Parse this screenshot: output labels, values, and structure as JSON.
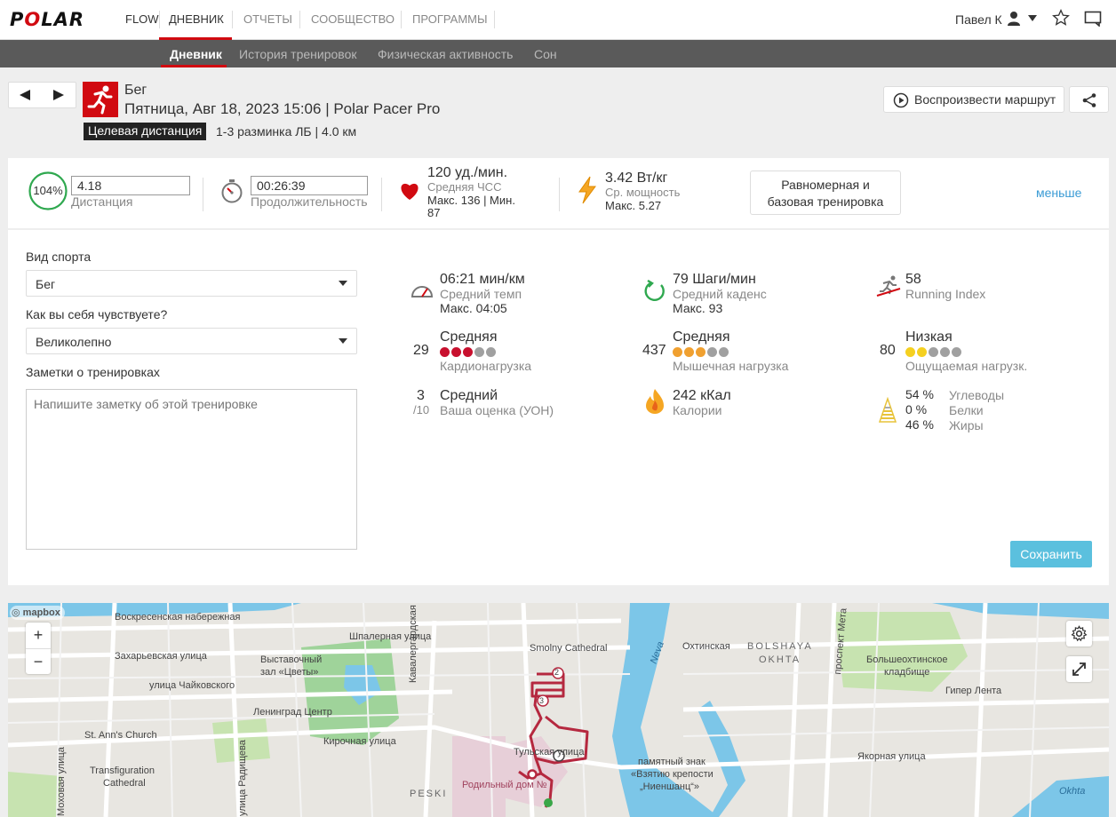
{
  "nav": {
    "logo": "POLAR",
    "flow": "FLOW",
    "items": [
      "ДНЕВНИК",
      "ОТЧЕТЫ",
      "СООБЩЕСТВО",
      "ПРОГРАММЫ"
    ],
    "user": "Павел К"
  },
  "subnav": [
    "Дневник",
    "История тренировок",
    "Физическая активность",
    "Сон"
  ],
  "session": {
    "sport": "Бег",
    "datetime": "Пятница, Авг 18, 2023 15:06 | Polar Pacer Pro",
    "target_badge": "Целевая дистанция",
    "target_text": "1-3 разминка ЛБ | 4.0 км",
    "replay": "Воспроизвести маршрут"
  },
  "summary": {
    "percent": "104%",
    "distance_value": "4.18",
    "distance_label": "Дистанция",
    "duration_value": "00:26:39",
    "duration_label": "Продолжительность",
    "hr_value": "120 уд./мин.",
    "hr_label": "Средняя ЧСС",
    "hr_minmax": "Макс. 136  |  Мин.",
    "hr_min": "87",
    "power_value": "3.42 Вт/кг",
    "power_label": "Ср. мощность",
    "power_max": "Макс. 5.27",
    "training_benefit_1": "Равномерная и",
    "training_benefit_2": "базовая тренировка",
    "less": "меньше"
  },
  "form": {
    "sport_label": "Вид спорта",
    "sport_value": "Бег",
    "feeling_label": "Как вы себя чувствуете?",
    "feeling_value": "Великолепно",
    "notes_label": "Заметки о тренировках",
    "notes_placeholder": "Напишите заметку об этой тренировке",
    "save": "Сохранить"
  },
  "metrics": {
    "pace_value": "06:21 мин/км",
    "pace_label": "Средний темп",
    "pace_max": "Макс. 04:05",
    "cadence_value": "79 Шаги/мин",
    "cadence_label": "Средний каденс",
    "cadence_max": "Макс. 93",
    "ri_value": "58",
    "ri_label": "Running Index",
    "cardio_num": "29",
    "cardio_level": "Средняя",
    "cardio_label": "Кардионагрузка",
    "cardio_dots": 3,
    "muscle_num": "437",
    "muscle_level": "Средняя",
    "muscle_label": "Мышечная нагрузка",
    "muscle_dots": 3,
    "perceived_num": "80",
    "perceived_level": "Низкая",
    "perceived_label": "Ощущаемая нагрузк.",
    "perceived_dots": 2,
    "rpe_num": "3",
    "rpe_den": "/10",
    "rpe_level": "Средний",
    "rpe_label": "Ваша оценка (УОН)",
    "cal_value": "242 кКал",
    "cal_label": "Калории",
    "carb_pct": "54 %",
    "carb_label": "Углеводы",
    "prot_pct": "0 %",
    "prot_label": "Белки",
    "fat_pct": "46 %",
    "fat_label": "Жиры"
  },
  "map": {
    "attribution": "mapbox",
    "labels": [
      "Воскресенская набережная",
      "Шпалерная улица",
      "Захарьевская улица",
      "Выставочный",
      "зал «Цветы»",
      "улица Чайковского",
      "Ленинград Центр",
      "St. Ann's Church",
      "Кирочная улица",
      "Transfiguration",
      "Cathedral",
      "Кавалергардская улица",
      "Smolny Cathedral",
      "Neva",
      "Охтинская",
      "BOLSHAYA",
      "OKHTA",
      "Большеохтинское",
      "кладбище",
      "Гипер Лента",
      "Тульская улица",
      "памятный знак",
      "«Взятию крепости",
      "„Ниеншанц“»",
      "Родильный дом №",
      "PESKI",
      "Якорная улица",
      "улица Радищева",
      "Моховая улица",
      "проспект Мета",
      "Okhta"
    ]
  },
  "colors": {
    "brand_red": "#d10a11",
    "save_blue": "#5bc0de",
    "less_link": "#3a9bd5",
    "cardio_dot": "#c8102e",
    "muscle_dot": "#f0a030",
    "perceived_dot": "#f5d020",
    "dot_off": "#a0a0a0"
  }
}
